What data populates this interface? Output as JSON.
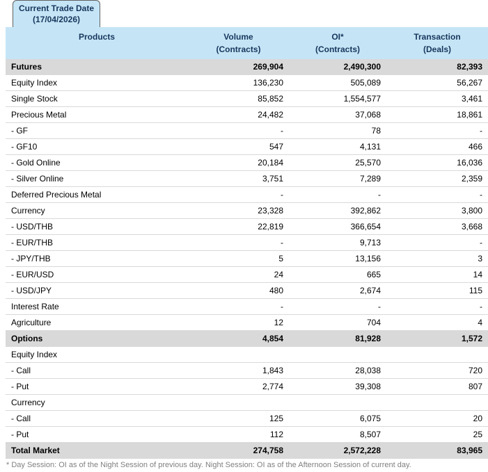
{
  "tab": {
    "line1": "Current Trade Date",
    "line2": "(17/04/2026)"
  },
  "colors": {
    "header_bg": "#c5e5f6",
    "header_text": "#17365d",
    "section_bg": "#d9d9d9",
    "row_border": "#d9d9d9",
    "tab_border": "#5f5f5f",
    "footnote_text": "#808080"
  },
  "table": {
    "headers": [
      {
        "line1": "Products",
        "line2": ""
      },
      {
        "line1": "Volume",
        "line2": "(Contracts)"
      },
      {
        "line1": "OI*",
        "line2": "(Contracts)"
      },
      {
        "line1": "Transaction",
        "line2": "(Deals)"
      }
    ],
    "rows": [
      {
        "type": "section",
        "product": "Futures",
        "volume": "269,904",
        "oi": "2,490,300",
        "deals": "82,393"
      },
      {
        "type": "data",
        "product": "Equity Index",
        "volume": "136,230",
        "oi": "505,089",
        "deals": "56,267"
      },
      {
        "type": "data",
        "product": "Single Stock",
        "volume": "85,852",
        "oi": "1,554,577",
        "deals": "3,461"
      },
      {
        "type": "data",
        "product": "Precious Metal",
        "volume": "24,482",
        "oi": "37,068",
        "deals": "18,861"
      },
      {
        "type": "data",
        "product": "- GF",
        "volume": "-",
        "oi": "78",
        "deals": "-"
      },
      {
        "type": "data",
        "product": "- GF10",
        "volume": "547",
        "oi": "4,131",
        "deals": "466"
      },
      {
        "type": "data",
        "product": "- Gold Online",
        "volume": "20,184",
        "oi": "25,570",
        "deals": "16,036"
      },
      {
        "type": "data",
        "product": "- Silver Online",
        "volume": "3,751",
        "oi": "7,289",
        "deals": "2,359"
      },
      {
        "type": "data",
        "product": "Deferred Precious Metal",
        "volume": "-",
        "oi": "-",
        "deals": "-"
      },
      {
        "type": "data",
        "product": "Currency",
        "volume": "23,328",
        "oi": "392,862",
        "deals": "3,800"
      },
      {
        "type": "data",
        "product": "- USD/THB",
        "volume": "22,819",
        "oi": "366,654",
        "deals": "3,668"
      },
      {
        "type": "data",
        "product": "- EUR/THB",
        "volume": "-",
        "oi": "9,713",
        "deals": "-"
      },
      {
        "type": "data",
        "product": "- JPY/THB",
        "volume": "5",
        "oi": "13,156",
        "deals": "3"
      },
      {
        "type": "data",
        "product": "- EUR/USD",
        "volume": "24",
        "oi": "665",
        "deals": "14"
      },
      {
        "type": "data",
        "product": "- USD/JPY",
        "volume": "480",
        "oi": "2,674",
        "deals": "115"
      },
      {
        "type": "data",
        "product": "Interest Rate",
        "volume": "-",
        "oi": "-",
        "deals": "-"
      },
      {
        "type": "data",
        "product": "Agriculture",
        "volume": "12",
        "oi": "704",
        "deals": "4"
      },
      {
        "type": "section",
        "product": "Options",
        "volume": "4,854",
        "oi": "81,928",
        "deals": "1,572"
      },
      {
        "type": "data",
        "product": "Equity Index",
        "volume": "",
        "oi": "",
        "deals": ""
      },
      {
        "type": "data",
        "product": "- Call",
        "volume": "1,843",
        "oi": "28,038",
        "deals": "720"
      },
      {
        "type": "data",
        "product": "- Put",
        "volume": "2,774",
        "oi": "39,308",
        "deals": "807"
      },
      {
        "type": "data",
        "product": "Currency",
        "volume": "",
        "oi": "",
        "deals": ""
      },
      {
        "type": "data",
        "product": "- Call",
        "volume": "125",
        "oi": "6,075",
        "deals": "20"
      },
      {
        "type": "data",
        "product": "- Put",
        "volume": "112",
        "oi": "8,507",
        "deals": "25"
      },
      {
        "type": "section",
        "product": "Total Market",
        "volume": "274,758",
        "oi": "2,572,228",
        "deals": "83,965"
      }
    ]
  },
  "footnote": "* Day Session: OI as of the Night Session of previous day. Night Session: OI as of the Afternoon Session of current day."
}
